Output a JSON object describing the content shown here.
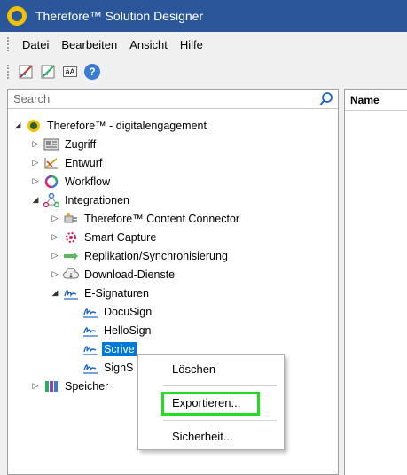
{
  "window": {
    "title": "Therefore™ Solution Designer"
  },
  "menu": [
    "Datei",
    "Bearbeiten",
    "Ansicht",
    "Hilfe"
  ],
  "toolbar": {
    "help_label": "?",
    "abc_label": "áA"
  },
  "search": {
    "placeholder": "Search"
  },
  "right_pane": {
    "column_header": "Name"
  },
  "tree": {
    "root": "Therefore™ - digitalengagement",
    "zugriff": "Zugriff",
    "entwurf": "Entwurf",
    "workflow": "Workflow",
    "integrationen": "Integrationen",
    "content_connector": "Therefore™ Content Connector",
    "smart_capture": "Smart Capture",
    "replikation": "Replikation/Synchronisierung",
    "download": "Download-Dienste",
    "esignaturen": "E-Signaturen",
    "docusign": "DocuSign",
    "hellosign": "HelloSign",
    "scrive": "Scrive",
    "signs": "SignS",
    "speicher": "Speicher"
  },
  "context_menu": {
    "loeschen": "Löschen",
    "exportieren": "Exportieren...",
    "sicherheit": "Sicherheit..."
  },
  "colors": {
    "titlebar": "#2b579a",
    "selection": "#0078d7",
    "highlight": "#22dd22"
  }
}
